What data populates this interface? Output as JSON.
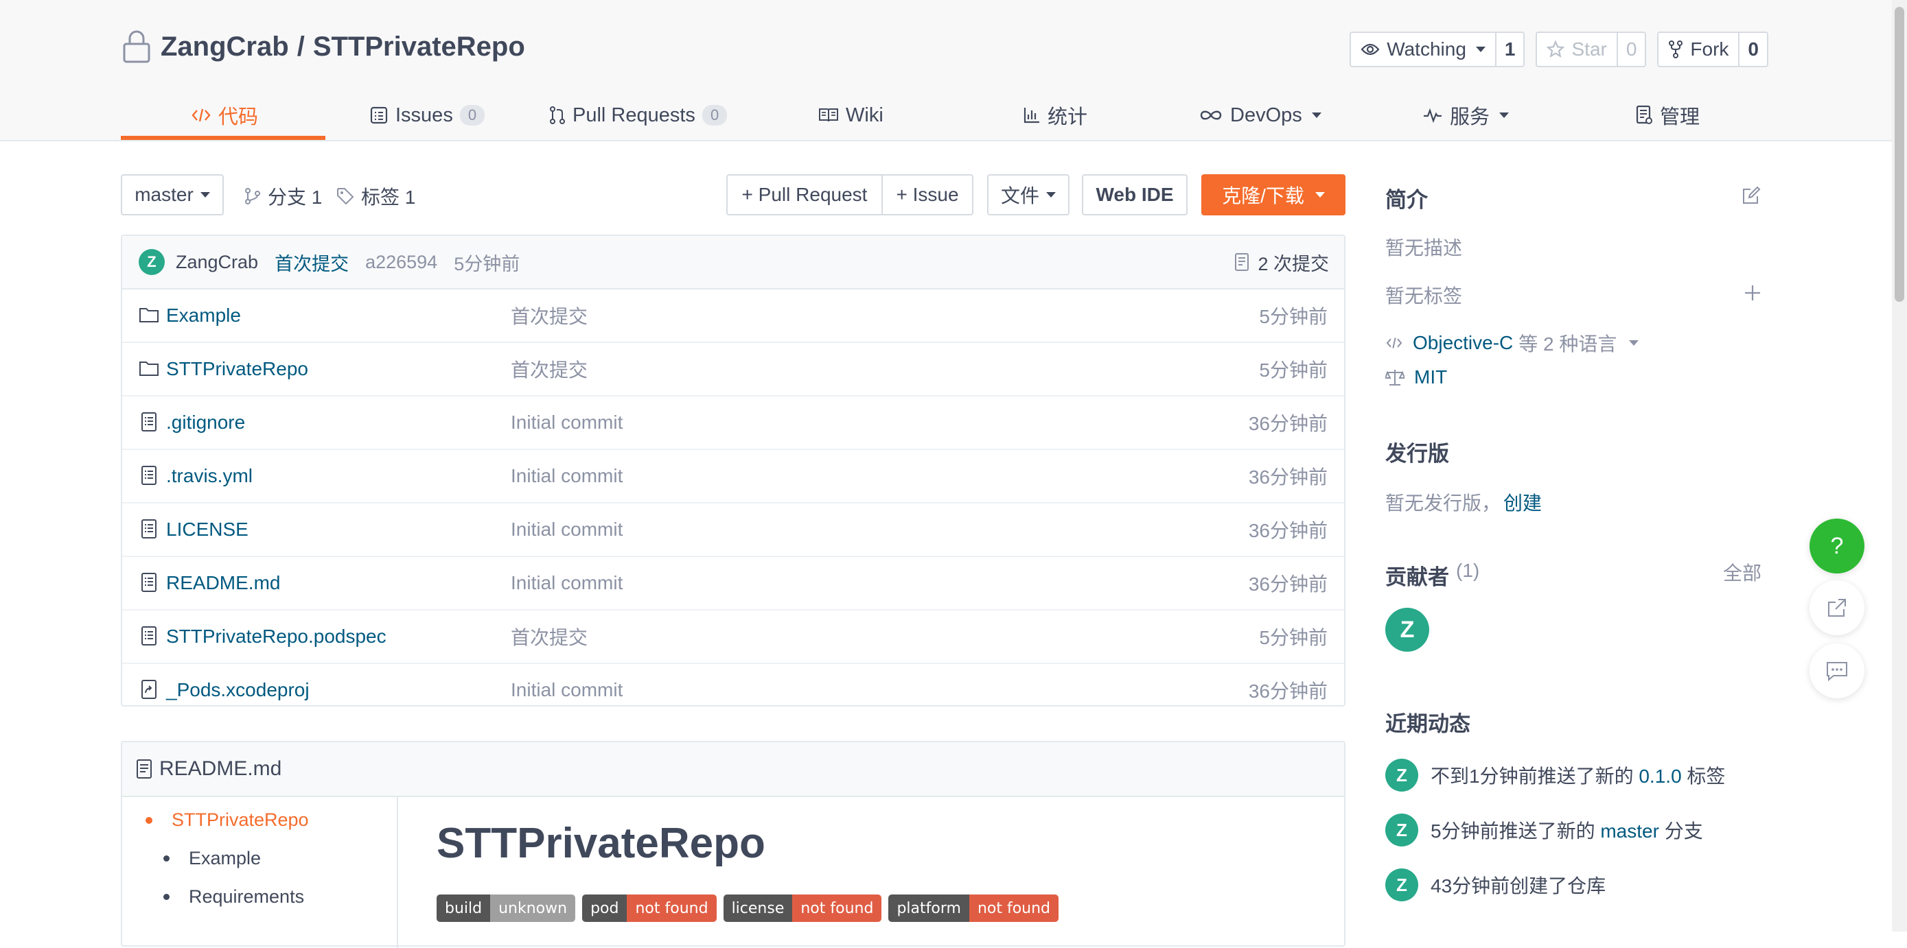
{
  "repo": {
    "owner": "ZangCrab",
    "separator": "/",
    "name": "STTPrivateRepo"
  },
  "actions": {
    "watch": {
      "label": "Watching",
      "count": "1"
    },
    "star": {
      "label": "Star",
      "count": "0"
    },
    "fork": {
      "label": "Fork",
      "count": "0"
    }
  },
  "tabs": [
    {
      "label": "代码"
    },
    {
      "label": "Issues",
      "count": "0"
    },
    {
      "label": "Pull Requests",
      "count": "0"
    },
    {
      "label": "Wiki"
    },
    {
      "label": "统计"
    },
    {
      "label": "DevOps"
    },
    {
      "label": "服务"
    },
    {
      "label": "管理"
    }
  ],
  "toolbar": {
    "branch": "master",
    "branches": "分支 1",
    "tags": "标签 1",
    "pull_request": "+ Pull Request",
    "issue": "+ Issue",
    "file": "文件",
    "web_ide": "Web IDE",
    "clone": "克隆/下载"
  },
  "latest_commit": {
    "avatar": "Z",
    "author": "ZangCrab",
    "message": "首次提交",
    "hash": "a226594",
    "time": "5分钟前",
    "count": "2 次提交"
  },
  "files": [
    {
      "name": "Example",
      "type": "folder",
      "message": "首次提交",
      "time": "5分钟前"
    },
    {
      "name": "STTPrivateRepo",
      "type": "folder",
      "message": "首次提交",
      "time": "5分钟前"
    },
    {
      "name": ".gitignore",
      "type": "file",
      "message": "Initial commit",
      "time": "36分钟前"
    },
    {
      "name": ".travis.yml",
      "type": "file",
      "message": "Initial commit",
      "time": "36分钟前"
    },
    {
      "name": "LICENSE",
      "type": "file",
      "message": "Initial commit",
      "time": "36分钟前"
    },
    {
      "name": "README.md",
      "type": "file",
      "message": "Initial commit",
      "time": "36分钟前"
    },
    {
      "name": "STTPrivateRepo.podspec",
      "type": "file",
      "message": "首次提交",
      "time": "5分钟前"
    },
    {
      "name": "_Pods.xcodeproj",
      "type": "link",
      "message": "Initial commit",
      "time": "36分钟前"
    }
  ],
  "readme": {
    "filename": "README.md",
    "toc": [
      "STTPrivateRepo",
      "Example",
      "Requirements"
    ],
    "title": "STTPrivateRepo",
    "badges": [
      {
        "key": "build",
        "value": "unknown",
        "color": "#9f9f9f"
      },
      {
        "key": "pod",
        "value": "not found",
        "color": "#e05d44"
      },
      {
        "key": "license",
        "value": "not found",
        "color": "#e05d44"
      },
      {
        "key": "platform",
        "value": "not found",
        "color": "#e05d44"
      }
    ]
  },
  "sidebar": {
    "intro_title": "简介",
    "no_description": "暂无描述",
    "no_tags": "暂无标签",
    "language": "Objective-C",
    "language_suffix": "等 2 种语言",
    "license": "MIT",
    "release_title": "发行版",
    "no_release": "暂无发行版，",
    "create_link": "创建",
    "contributors_title": "贡献者",
    "contributors_count": "(1)",
    "all_link": "全部",
    "contributor_avatar": "Z",
    "activity_title": "近期动态",
    "activities": [
      {
        "avatar": "Z",
        "pre": "不到1分钟前推送了新的",
        "link": "0.1.0",
        "post": "标签"
      },
      {
        "avatar": "Z",
        "pre": "5分钟前推送了新的",
        "link": "master",
        "post": "分支"
      },
      {
        "avatar": "Z",
        "pre": "43分钟前创建了仓库",
        "link": "",
        "post": ""
      }
    ]
  },
  "floating": {
    "help": "?"
  },
  "colors": {
    "accent": "#f56c2c",
    "link": "#005980",
    "avatar": "#27a98a",
    "help": "#2db933"
  }
}
